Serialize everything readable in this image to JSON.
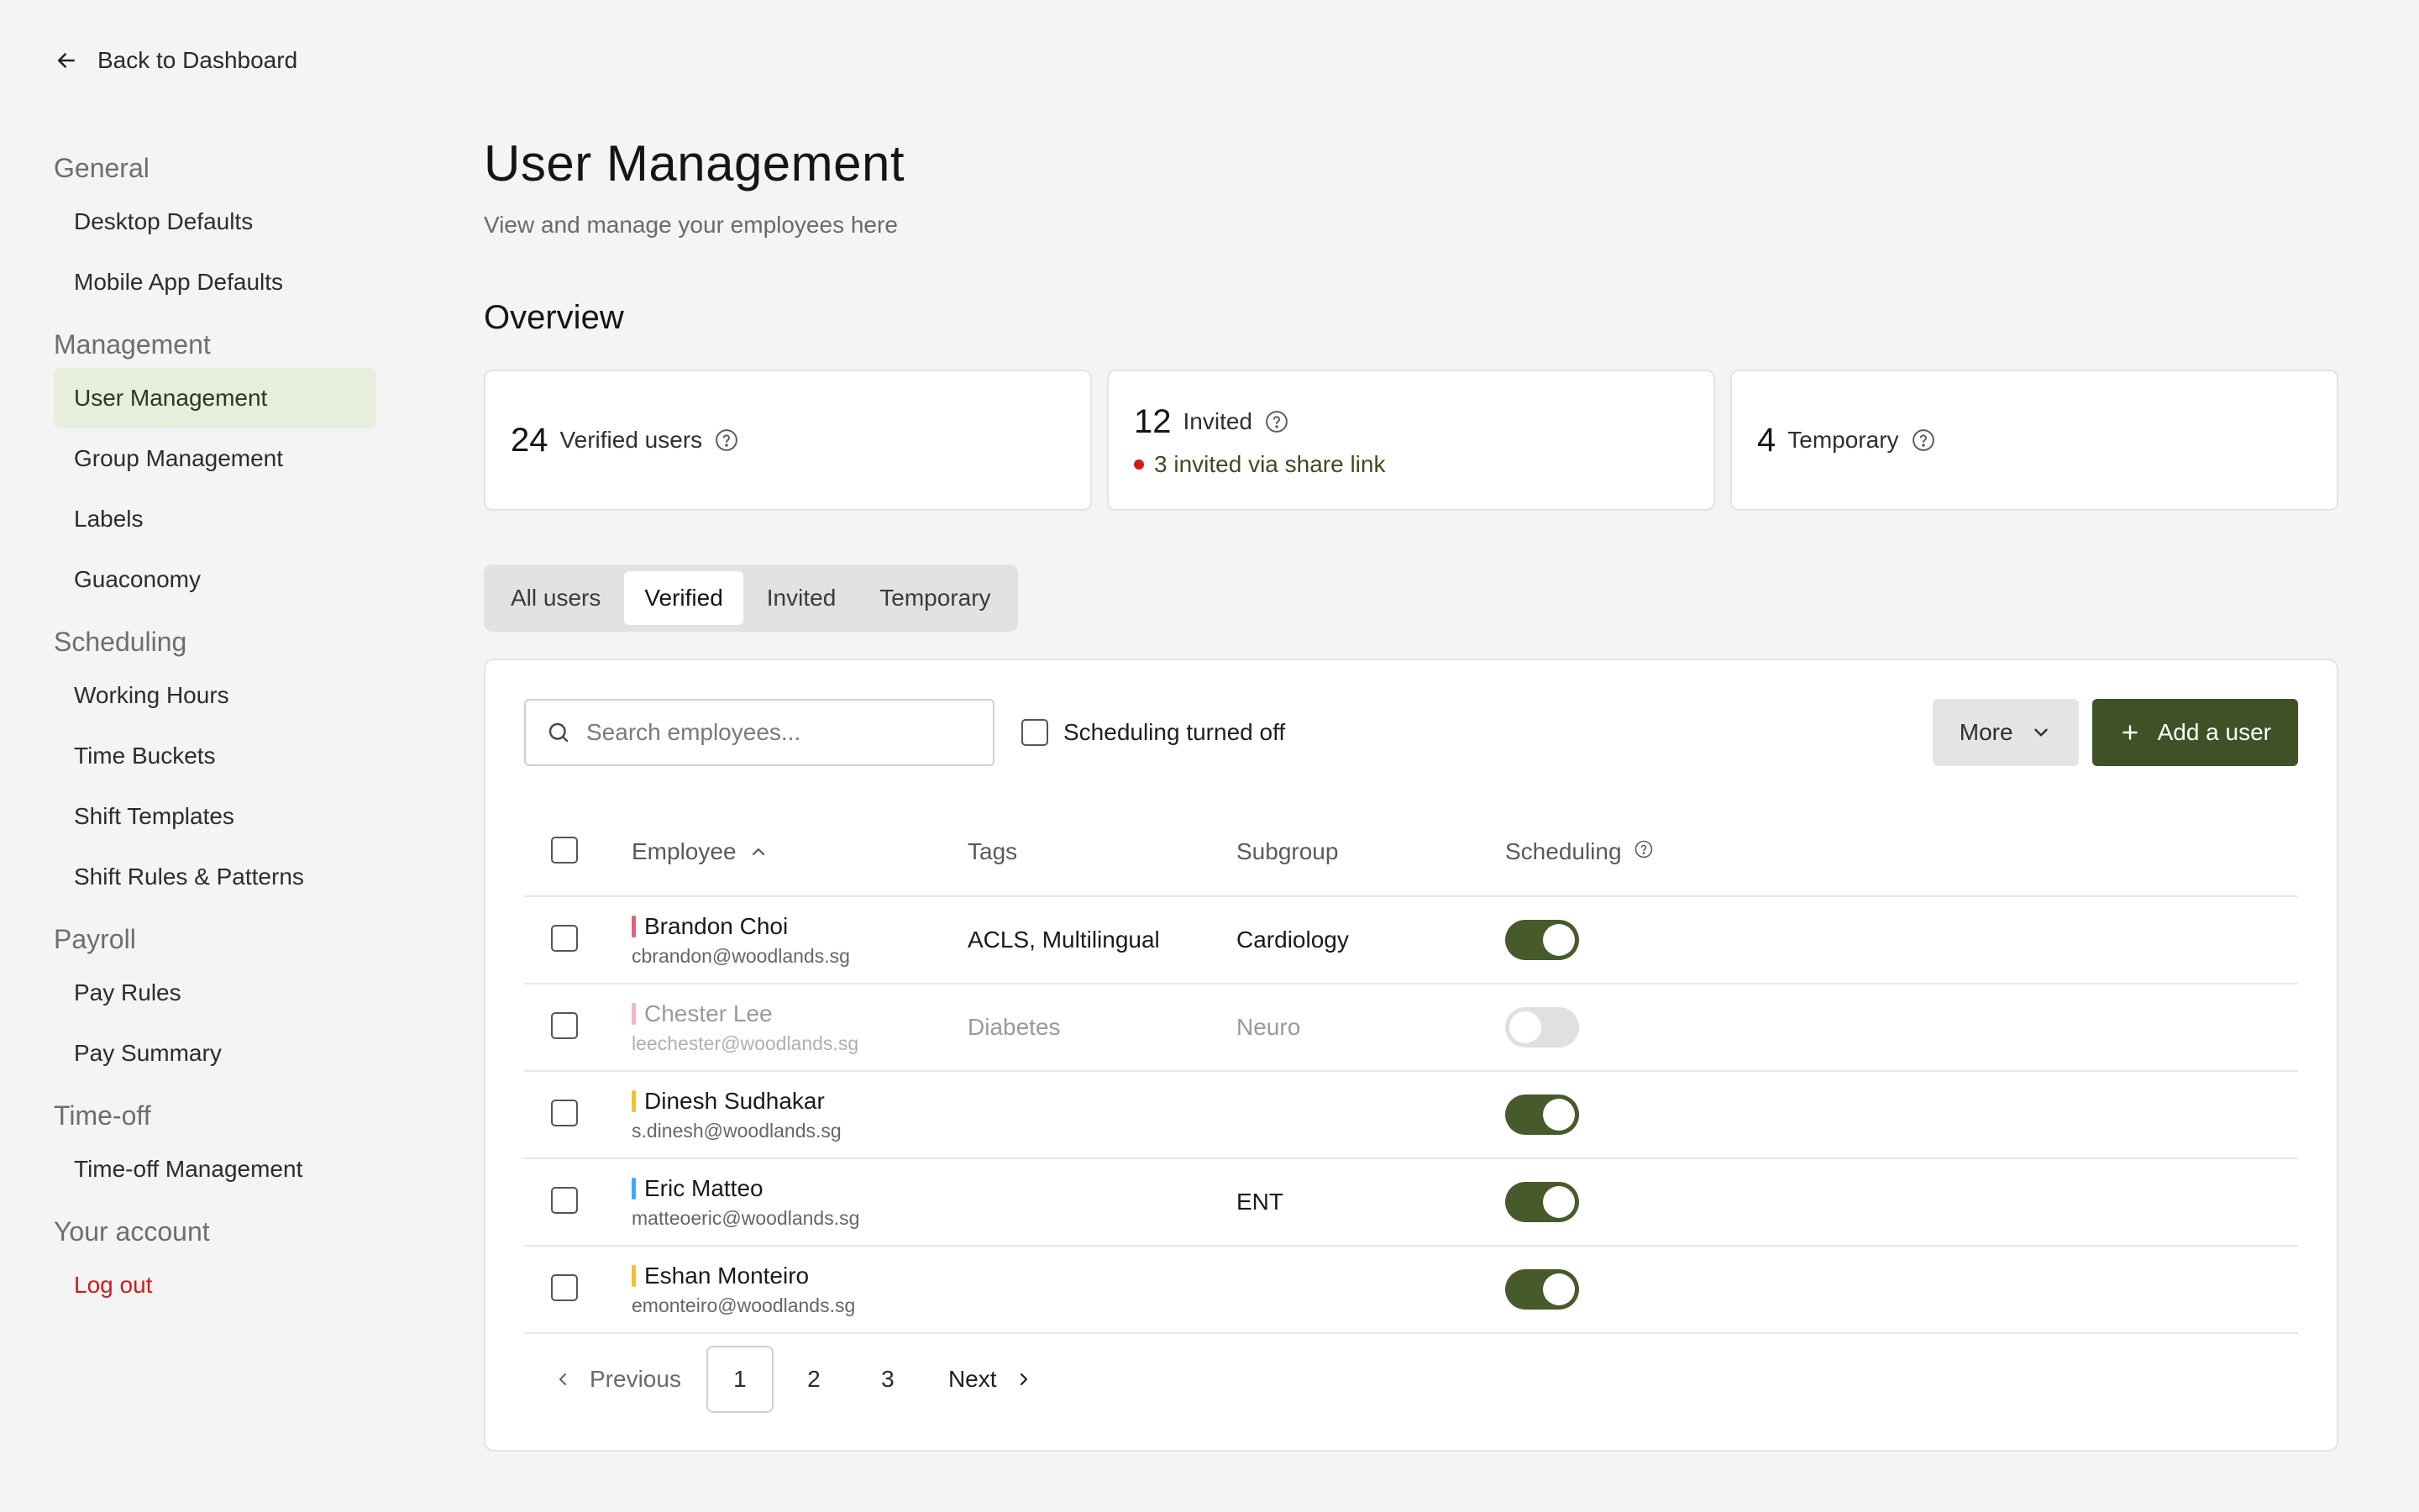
{
  "back_link": {
    "label": "Back to Dashboard",
    "icon": "arrow-left-icon"
  },
  "sidebar": {
    "sections": [
      {
        "heading": "General",
        "items": [
          "Desktop Defaults",
          "Mobile App Defaults"
        ]
      },
      {
        "heading": "Management",
        "items": [
          "User Management",
          "Group Management",
          "Labels",
          "Guaconomy"
        ]
      },
      {
        "heading": "Scheduling",
        "items": [
          "Working Hours",
          "Time Buckets",
          "Shift Templates",
          "Shift Rules & Patterns"
        ]
      },
      {
        "heading": "Payroll",
        "items": [
          "Pay Rules",
          "Pay Summary"
        ]
      },
      {
        "heading": "Time-off",
        "items": [
          "Time-off Management"
        ]
      },
      {
        "heading": "Your account",
        "items": [
          "Log out"
        ]
      }
    ],
    "active_item": "User Management"
  },
  "page": {
    "title": "User Management",
    "subtitle": "View and manage your employees here",
    "overview_title": "Overview"
  },
  "overview": {
    "verified": {
      "count": "24",
      "label": "Verified users"
    },
    "invited": {
      "count": "12",
      "label": "Invited",
      "note": "3 invited via share link"
    },
    "temporary": {
      "count": "4",
      "label": "Temporary"
    }
  },
  "tabs": {
    "items": [
      "All users",
      "Verified",
      "Invited",
      "Temporary"
    ],
    "active": "Verified"
  },
  "toolbar": {
    "search_placeholder": "Search employees...",
    "filter_label": "Scheduling turned off",
    "more_label": "More",
    "add_label": "Add a user"
  },
  "table": {
    "headers": {
      "employee": "Employee",
      "tags": "Tags",
      "subgroup": "Subgroup",
      "scheduling": "Scheduling"
    },
    "rows": [
      {
        "name": "Brandon Choi",
        "email": "cbrandon@woodlands.sg",
        "tags": "ACLS, Multilingual",
        "subgroup": "Cardiology",
        "scheduling": true,
        "muted": false,
        "color": "#e0607a"
      },
      {
        "name": "Chester Lee",
        "email": "leechester@woodlands.sg",
        "tags": "Diabetes",
        "subgroup": "Neuro",
        "scheduling": false,
        "muted": true,
        "color": "#f0b7c2"
      },
      {
        "name": "Dinesh Sudhakar",
        "email": "s.dinesh@woodlands.sg",
        "tags": "",
        "subgroup": "",
        "scheduling": true,
        "muted": false,
        "color": "#f2c22e"
      },
      {
        "name": "Eric Matteo",
        "email": "matteoeric@woodlands.sg",
        "tags": "",
        "subgroup": "ENT",
        "scheduling": true,
        "muted": false,
        "color": "#3fa9f5"
      },
      {
        "name": "Eshan Monteiro",
        "email": "emonteiro@woodlands.sg",
        "tags": "",
        "subgroup": "",
        "scheduling": true,
        "muted": false,
        "color": "#f2c22e"
      }
    ]
  },
  "pagination": {
    "previous": "Previous",
    "pages": [
      "1",
      "2",
      "3"
    ],
    "current": "1",
    "next": "Next"
  },
  "colors": {
    "accent": "#3f5227",
    "active_nav": "#e7eedb",
    "danger": "#d11a1a"
  }
}
